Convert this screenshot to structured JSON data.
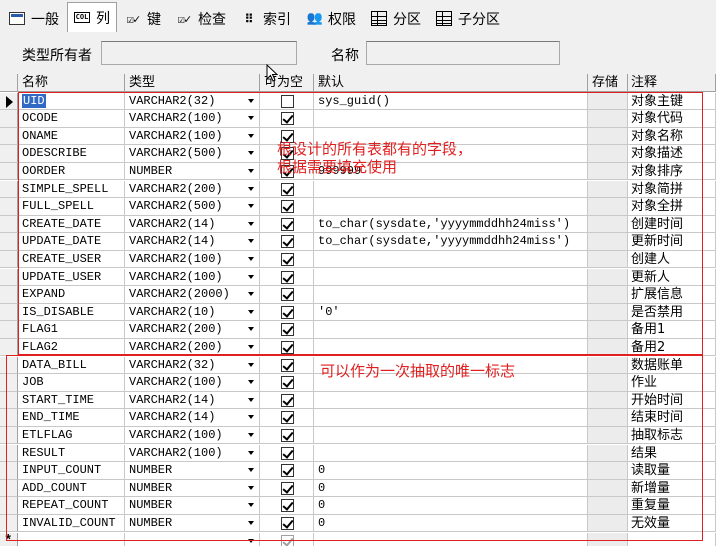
{
  "tabs": [
    {
      "label": "一般",
      "icon": "general-icon",
      "active": false
    },
    {
      "label": "列",
      "icon": "columns-icon",
      "active": true
    },
    {
      "label": "键",
      "icon": "key-check-icon",
      "active": false
    },
    {
      "label": "检查",
      "icon": "check-constraint-icon",
      "active": false
    },
    {
      "label": "索引",
      "icon": "index-icon",
      "active": false
    },
    {
      "label": "权限",
      "icon": "privileges-icon",
      "active": false
    },
    {
      "label": "分区",
      "icon": "partition-icon",
      "active": false
    },
    {
      "label": "子分区",
      "icon": "subpartition-icon",
      "active": false
    }
  ],
  "filter": {
    "owner_label": "类型所有者",
    "owner_value": "",
    "name_label": "名称",
    "name_value": ""
  },
  "columns": [
    "名称",
    "类型",
    "可为空",
    "默认",
    "存储",
    "注释"
  ],
  "rows": [
    {
      "name": "UID",
      "type": "VARCHAR2(32)",
      "nullable": false,
      "default": "sys_guid()",
      "comment": "对象主键",
      "current": true
    },
    {
      "name": "OCODE",
      "type": "VARCHAR2(100)",
      "nullable": true,
      "default": "",
      "comment": "对象代码"
    },
    {
      "name": "ONAME",
      "type": "VARCHAR2(100)",
      "nullable": true,
      "default": "",
      "comment": "对象名称"
    },
    {
      "name": "ODESCRIBE",
      "type": "VARCHAR2(500)",
      "nullable": true,
      "default": "",
      "comment": "对象描述"
    },
    {
      "name": "OORDER",
      "type": "NUMBER",
      "nullable": true,
      "default": "999999",
      "comment": "对象排序"
    },
    {
      "name": "SIMPLE_SPELL",
      "type": "VARCHAR2(200)",
      "nullable": true,
      "default": "",
      "comment": "对象简拼"
    },
    {
      "name": "FULL_SPELL",
      "type": "VARCHAR2(500)",
      "nullable": true,
      "default": "",
      "comment": "对象全拼"
    },
    {
      "name": "CREATE_DATE",
      "type": "VARCHAR2(14)",
      "nullable": true,
      "default": "to_char(sysdate,'yyyymmddhh24miss')",
      "comment": "创建时间"
    },
    {
      "name": "UPDATE_DATE",
      "type": "VARCHAR2(14)",
      "nullable": true,
      "default": "to_char(sysdate,'yyyymmddhh24miss')",
      "comment": "更新时间"
    },
    {
      "name": "CREATE_USER",
      "type": "VARCHAR2(100)",
      "nullable": true,
      "default": "",
      "comment": "创建人"
    },
    {
      "name": "UPDATE_USER",
      "type": "VARCHAR2(100)",
      "nullable": true,
      "default": "",
      "comment": "更新人"
    },
    {
      "name": "EXPAND",
      "type": "VARCHAR2(2000)",
      "nullable": true,
      "default": "",
      "comment": "扩展信息"
    },
    {
      "name": "IS_DISABLE",
      "type": "VARCHAR2(10)",
      "nullable": true,
      "default": "'0'",
      "comment": "是否禁用"
    },
    {
      "name": "FLAG1",
      "type": "VARCHAR2(200)",
      "nullable": true,
      "default": "",
      "comment": "备用1"
    },
    {
      "name": "FLAG2",
      "type": "VARCHAR2(200)",
      "nullable": true,
      "default": "",
      "comment": "备用2"
    },
    {
      "name": "DATA_BILL",
      "type": "VARCHAR2(32)",
      "nullable": true,
      "default": "",
      "comment": "数据账单"
    },
    {
      "name": "JOB",
      "type": "VARCHAR2(100)",
      "nullable": true,
      "default": "",
      "comment": "作业"
    },
    {
      "name": "START_TIME",
      "type": "VARCHAR2(14)",
      "nullable": true,
      "default": "",
      "comment": "开始时间"
    },
    {
      "name": "END_TIME",
      "type": "VARCHAR2(14)",
      "nullable": true,
      "default": "",
      "comment": "结束时间"
    },
    {
      "name": "ETLFLAG",
      "type": "VARCHAR2(100)",
      "nullable": true,
      "default": "",
      "comment": "抽取标志"
    },
    {
      "name": "RESULT",
      "type": "VARCHAR2(100)",
      "nullable": true,
      "default": "",
      "comment": "结果"
    },
    {
      "name": "INPUT_COUNT",
      "type": "NUMBER",
      "nullable": true,
      "default": "0",
      "comment": "读取量"
    },
    {
      "name": "ADD_COUNT",
      "type": "NUMBER",
      "nullable": true,
      "default": "0",
      "comment": "新增量"
    },
    {
      "name": "REPEAT_COUNT",
      "type": "NUMBER",
      "nullable": true,
      "default": "0",
      "comment": "重复量"
    },
    {
      "name": "INVALID_COUNT",
      "type": "NUMBER",
      "nullable": true,
      "default": "0",
      "comment": "无效量"
    }
  ],
  "new_row": {
    "indicator": "*",
    "nullable": true
  },
  "annotations": {
    "note1_line1": "根设计的所有表都有的字段，",
    "note1_line2": "根据需要填充使用",
    "note2": "可以作为一次抽取的唯一标志",
    "color": "#e02020"
  }
}
